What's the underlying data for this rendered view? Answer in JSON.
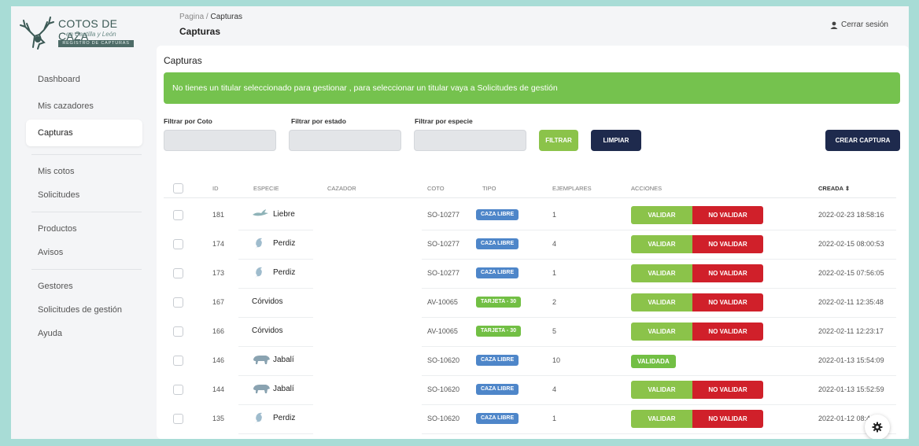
{
  "brand": {
    "title": "COTOS DE CAZA",
    "subtitle": "en Castilla y León",
    "band": "REGISTRO DE CAPTURAS"
  },
  "sidebar": {
    "items": [
      {
        "label": "Dashboard"
      },
      {
        "label": "Mis cazadores"
      },
      {
        "label": "Capturas",
        "active": true
      },
      {
        "label": "Mis cotos"
      },
      {
        "label": "Solicitudes"
      },
      {
        "label": "Productos"
      },
      {
        "label": "Avisos"
      },
      {
        "label": "Gestores"
      },
      {
        "label": "Solicitudes de gestión"
      },
      {
        "label": "Ayuda"
      }
    ]
  },
  "header": {
    "breadcrumb_root": "Pagina",
    "breadcrumb_sep": "/",
    "breadcrumb_current": "Capturas",
    "title": "Capturas",
    "logout": "Cerrar sesión"
  },
  "main": {
    "card_title": "Capturas",
    "alert": "No tienes un titular seleccionado para gestionar , para seleccionar un titular vaya a Solicitudes de gestión",
    "filters": {
      "coto_label": "Filtrar por Coto",
      "estado_label": "Filtrar por estado",
      "especie_label": "Filtrar por especie",
      "filtrar_button": "FILTRAR",
      "limpiar_button": "LIMPIAR",
      "crear_button": "CREAR CAPTURA"
    },
    "table": {
      "headers": {
        "id": "ID",
        "especie": "ESPECIE",
        "cazador": "CAZADOR",
        "coto": "COTO",
        "tipo": "TIPO",
        "ejemplares": "EJEMPLARES",
        "acciones": "ACCIONES",
        "creada": "CREADA ⇕"
      },
      "validar_label": "VALIDAR",
      "no_validar_label": "NO VALIDAR",
      "rows": [
        {
          "id": "181",
          "especie": "Liebre",
          "icon": "hare-icon",
          "coto": "SO-10277",
          "tipo": "CAZA LIBRE",
          "tipo_kind": "libre",
          "ejemplares": "1",
          "estado": "pending",
          "creada": "2022-02-23 18:58:16"
        },
        {
          "id": "174",
          "especie": "Perdiz",
          "icon": "partridge-icon",
          "coto": "SO-10277",
          "tipo": "CAZA LIBRE",
          "tipo_kind": "libre",
          "ejemplares": "4",
          "estado": "pending",
          "creada": "2022-02-15 08:00:53"
        },
        {
          "id": "173",
          "especie": "Perdiz",
          "icon": "partridge-icon",
          "coto": "SO-10277",
          "tipo": "CAZA LIBRE",
          "tipo_kind": "libre",
          "ejemplares": "1",
          "estado": "pending",
          "creada": "2022-02-15 07:56:05"
        },
        {
          "id": "167",
          "especie": "Córvidos",
          "icon": "",
          "coto": "AV-10065",
          "tipo": "TARJETA - 30",
          "tipo_kind": "tarjeta",
          "ejemplares": "2",
          "estado": "pending",
          "creada": "2022-02-11 12:35:48"
        },
        {
          "id": "166",
          "especie": "Córvidos",
          "icon": "",
          "coto": "AV-10065",
          "tipo": "TARJETA - 30",
          "tipo_kind": "tarjeta",
          "ejemplares": "5",
          "estado": "pending",
          "creada": "2022-02-11 12:23:17"
        },
        {
          "id": "146",
          "especie": "Jabalí",
          "icon": "boar-icon",
          "coto": "SO-10620",
          "tipo": "CAZA LIBRE",
          "tipo_kind": "libre",
          "ejemplares": "10",
          "estado": "VALIDADA",
          "creada": "2022-01-13 15:54:09"
        },
        {
          "id": "144",
          "especie": "Jabalí",
          "icon": "boar-icon",
          "coto": "SO-10620",
          "tipo": "CAZA LIBRE",
          "tipo_kind": "libre",
          "ejemplares": "4",
          "estado": "pending",
          "creada": "2022-01-13 15:52:59"
        },
        {
          "id": "135",
          "especie": "Perdiz",
          "icon": "partridge-icon",
          "coto": "SO-10620",
          "tipo": "CAZA LIBRE",
          "tipo_kind": "libre",
          "ejemplares": "1",
          "estado": "pending",
          "creada": "2022-01-12 08:44:3"
        }
      ]
    }
  },
  "colors": {
    "accent_green": "#75c24e",
    "navy": "#1e2a4d",
    "danger_red": "#d0202a",
    "badge_blue": "#4e86c9"
  }
}
